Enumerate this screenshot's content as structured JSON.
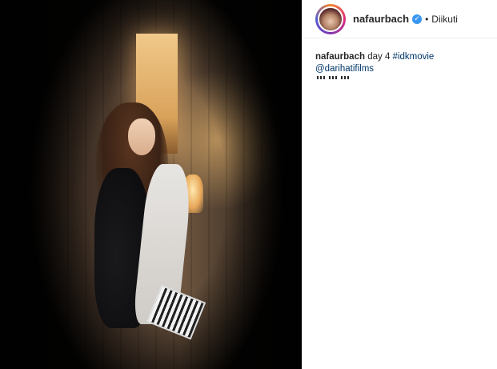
{
  "post": {
    "username": "nafaurbach",
    "verified": true,
    "separator": "•",
    "follow_status": "Diikuti",
    "caption": {
      "username": "nafaurbach",
      "text": "day 4",
      "hashtag": "#idkmovie",
      "mention": "@darihatifilms",
      "emojis": [
        "clapper-board-icon",
        "clapper-board-icon",
        "clapper-board-icon",
        "film-reel-icon",
        "film-reel-icon",
        "film-reel-icon"
      ]
    }
  },
  "colors": {
    "link": "#003569",
    "text": "#262626",
    "verified_badge": "#3897f0"
  }
}
